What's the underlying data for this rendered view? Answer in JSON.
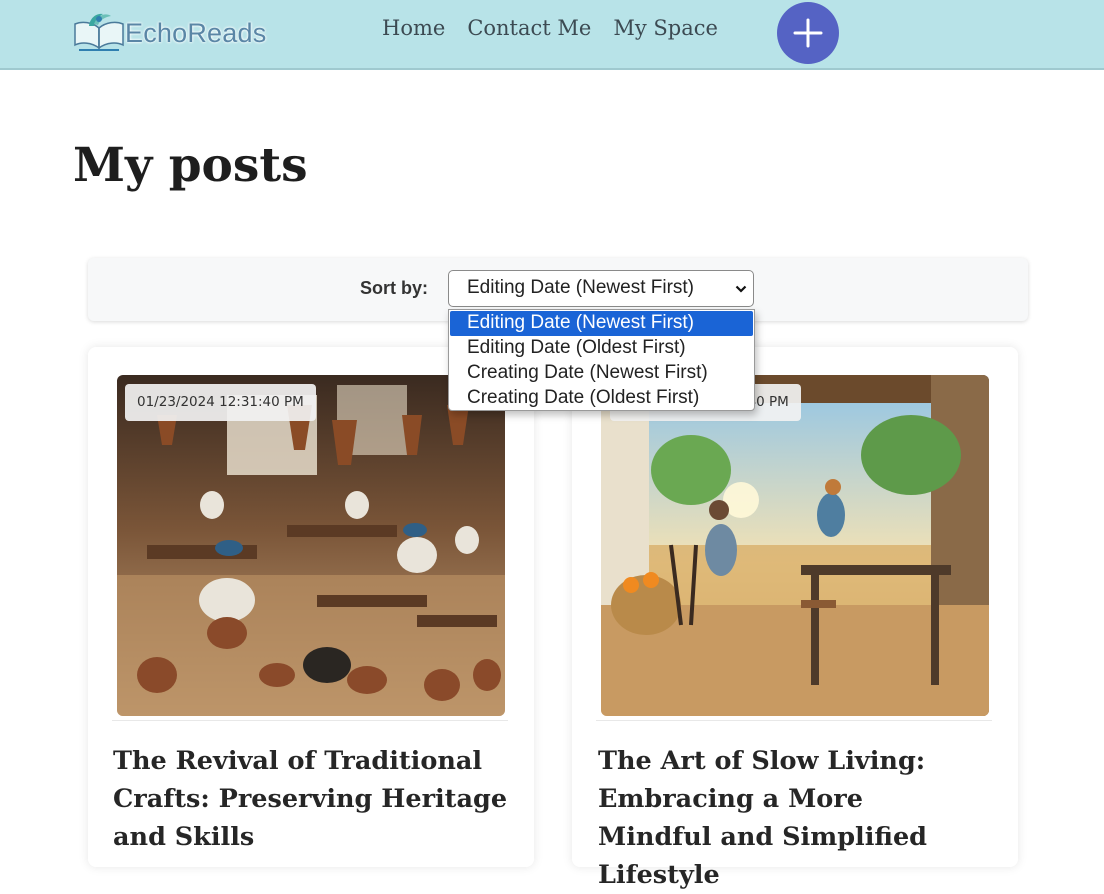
{
  "header": {
    "logo_text": "EchoReads",
    "nav": [
      "Home",
      "Contact Me",
      "My Space"
    ],
    "add_icon": "plus-icon",
    "colors": {
      "bar": "#b8e3e8",
      "add_button": "#5563c4"
    }
  },
  "main": {
    "title": "My posts",
    "sort": {
      "label": "Sort by:",
      "selected": "Editing Date (Newest First)",
      "options": [
        "Editing Date (Newest First)",
        "Editing Date (Oldest First)",
        "Creating Date (Newest First)",
        "Creating Date (Oldest First)"
      ],
      "highlight_color": "#1a64d6"
    },
    "posts": [
      {
        "date": "01/23/2024 12:31:40 PM",
        "title": "The Revival of Traditional Crafts: Preserving Heritage and Skills"
      },
      {
        "date": "40 PM",
        "title": "The Art of Slow Living: Embracing a More Mindful and Simplified Lifestyle"
      }
    ]
  }
}
